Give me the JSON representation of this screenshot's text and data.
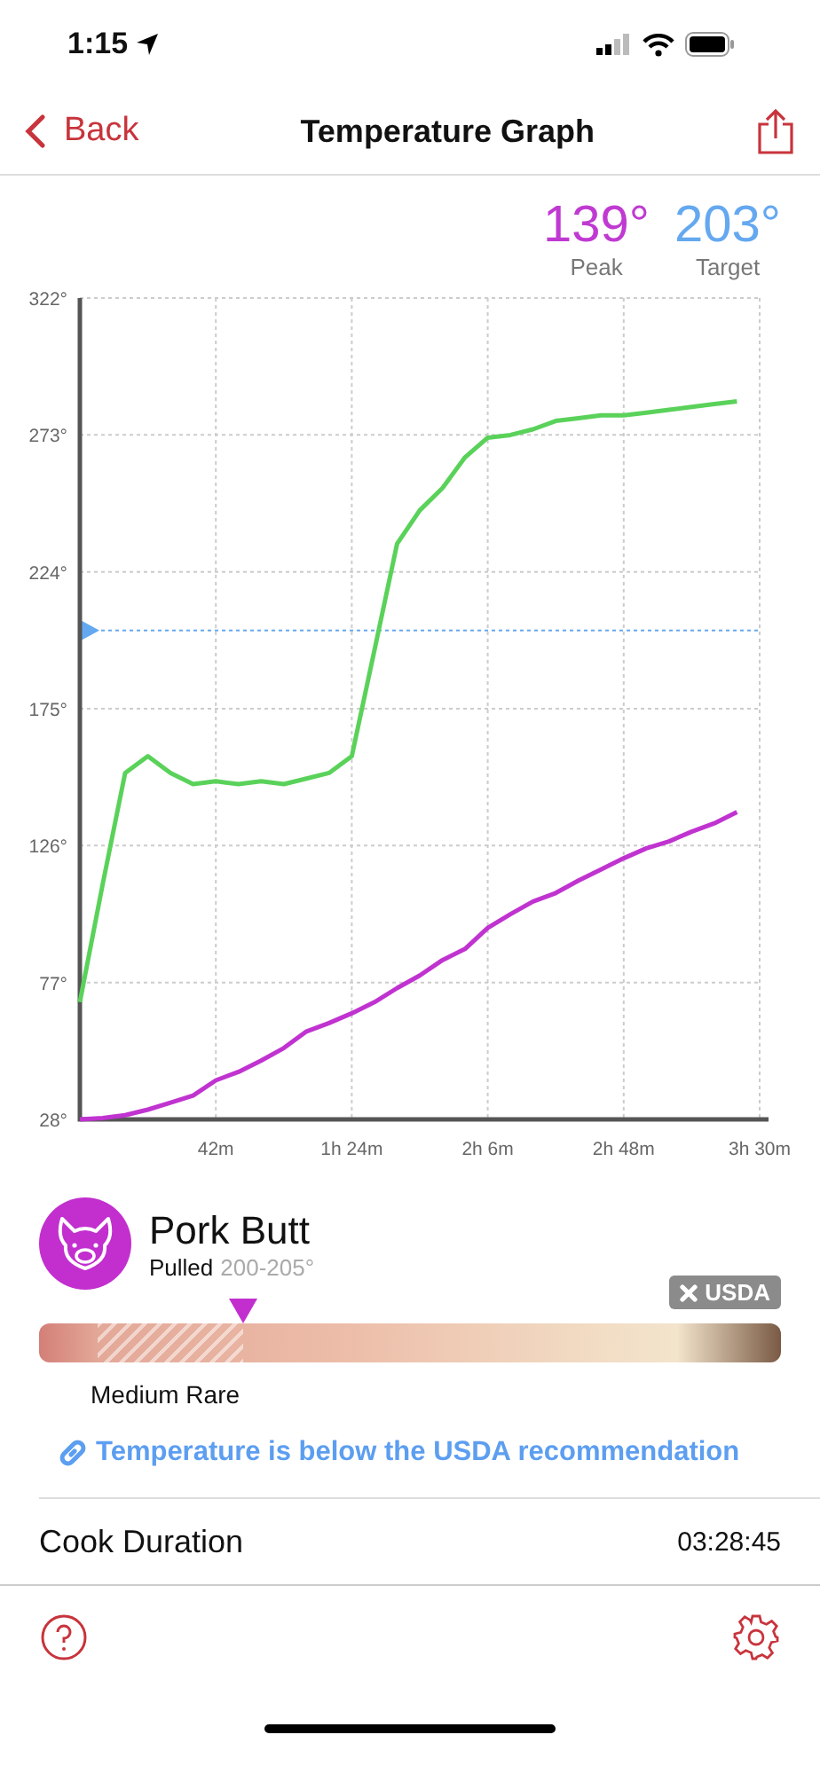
{
  "status_bar": {
    "time": "1:15"
  },
  "nav": {
    "back": "Back",
    "title": "Temperature Graph"
  },
  "readouts": [
    {
      "value": "139°",
      "label": "Peak",
      "color": "#c03ad2"
    },
    {
      "value": "203°",
      "label": "Target",
      "color": "#64a8f0"
    }
  ],
  "chart_data": {
    "type": "line",
    "categories": [
      null,
      null,
      null,
      null,
      null,
      null,
      "42m",
      null,
      null,
      null,
      null,
      null,
      "1h 24m",
      null,
      null,
      null,
      null,
      null,
      "2h 6m",
      null,
      null,
      null,
      null,
      null,
      "2h 48m",
      null,
      null,
      null,
      null,
      null,
      "3h 30m"
    ],
    "series": [
      {
        "color": "#5ad25a",
        "values": [
          70,
          112,
          152,
          158,
          152,
          148,
          149,
          148,
          149,
          148,
          150,
          152,
          158,
          196,
          234,
          246,
          254,
          265,
          272,
          273,
          275,
          278,
          279,
          280,
          280,
          281,
          282,
          283,
          284,
          285,
          null
        ]
      },
      {
        "color": "#c033d0",
        "values": [
          28,
          28.5,
          29.5,
          31.5,
          34,
          36.5,
          42,
          45,
          49,
          53.5,
          59.5,
          62.5,
          66,
          70,
          75,
          79.5,
          85,
          89,
          96.5,
          101.5,
          106,
          109,
          113.5,
          117.5,
          121.5,
          125,
          127.5,
          131,
          134,
          138,
          null
        ]
      }
    ],
    "ylim": [
      28,
      322
    ],
    "grid": true,
    "yticks": [
      {
        "value": 28,
        "label": "28°"
      },
      {
        "value": 77,
        "label": "77°"
      },
      {
        "value": 126,
        "label": "126°"
      },
      {
        "value": 175,
        "label": "175°"
      },
      {
        "value": 224,
        "label": "224°"
      },
      {
        "value": 273,
        "label": "273°"
      },
      {
        "value": 322,
        "label": "322°"
      }
    ],
    "ref_lines": [
      {
        "axis": "y",
        "value": 203
      }
    ]
  },
  "product": {
    "name": "Pork Butt",
    "doneness": "Pulled",
    "range": "200-205°",
    "badge": "USDA",
    "scale": {
      "level": 0.275,
      "label": "Medium Rare"
    },
    "warning": "Temperature is below the USDA recommendation"
  },
  "duration": {
    "label": "Cook Duration",
    "value": "03:28:45"
  }
}
